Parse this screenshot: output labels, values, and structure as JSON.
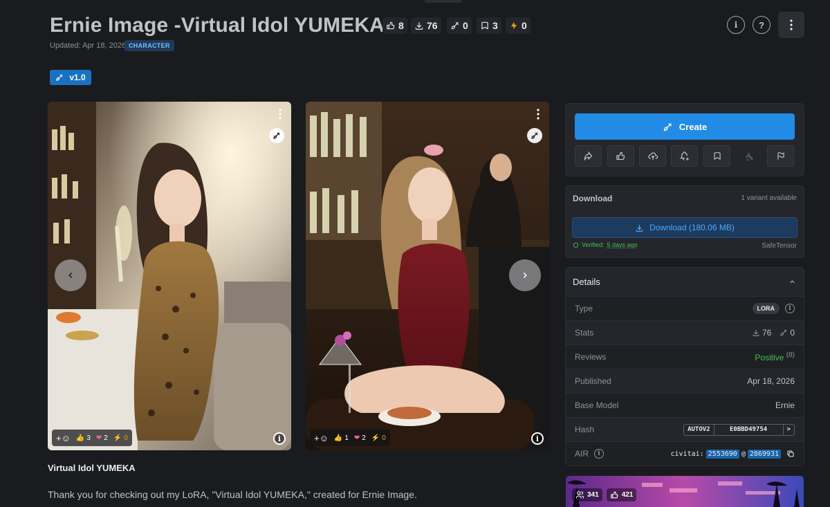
{
  "header": {
    "title": "Ernie Image -Virtual Idol YUMEKA-",
    "stats": {
      "likes": "8",
      "downloads": "76",
      "generations": "0",
      "collected": "3",
      "buzz": "0"
    },
    "updated": "Updated: Apr 18, 2026",
    "category": "CHARACTER",
    "info_icon": "i",
    "help_icon": "?"
  },
  "version": {
    "label": "v1.0"
  },
  "gallery": {
    "left": {
      "add_reaction": "+☺",
      "reactions": {
        "like": "3",
        "heart": "2",
        "buzz": "0"
      }
    },
    "right": {
      "add_reaction": "+☺",
      "reactions": {
        "like": "1",
        "heart": "2",
        "buzz": "0"
      }
    },
    "info_icon": "i"
  },
  "description": {
    "title": "Virtual Idol YUMEKA",
    "text": "Thank you for checking out my LoRA, \"Virtual Idol YUMEKA,\" created for Ernie Image."
  },
  "create": {
    "label": "Create"
  },
  "download": {
    "label": "Download",
    "variants": "1 variant available",
    "button": "Download (180.06 MB)",
    "verified_prefix": "Verified:",
    "verified_when": "5 days ago",
    "format": "SafeTensor"
  },
  "details": {
    "title": "Details",
    "type": {
      "key": "Type",
      "value": "LORA"
    },
    "stats": {
      "key": "Stats",
      "downloads": "76",
      "generations": "0"
    },
    "reviews": {
      "key": "Reviews",
      "value": "Positive",
      "count": "(8)"
    },
    "published": {
      "key": "Published",
      "value": "Apr 18, 2026"
    },
    "base_model": {
      "key": "Base Model",
      "value": "Ernie"
    },
    "hash": {
      "key": "Hash",
      "algo": "AUTOV2",
      "value": "E0BBD49754",
      "next": ">"
    },
    "air": {
      "key": "AIR",
      "prefix": "civitai:",
      "model_id": "2553690",
      "at": "@",
      "version_id": "2869931"
    }
  },
  "promo": {
    "users": "341",
    "likes": "421"
  },
  "colors": {
    "accent": "#228be6",
    "background": "#1a1b1e",
    "panel": "#25262b",
    "positive": "#40c057"
  }
}
